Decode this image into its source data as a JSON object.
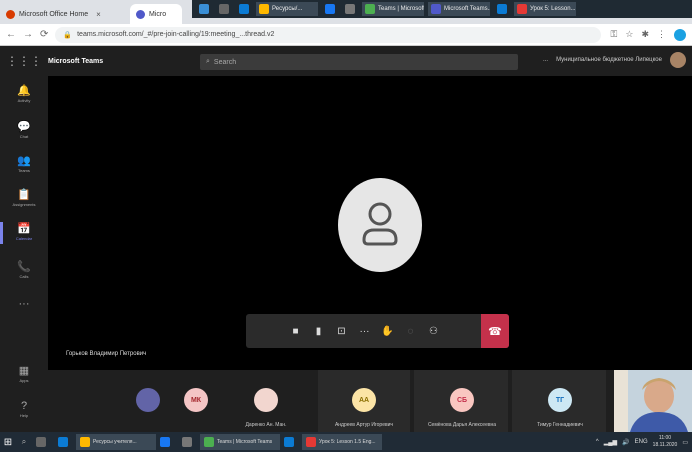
{
  "browser": {
    "tabs": [
      {
        "label": "Microsoft Office Home",
        "color": "#d83b01"
      },
      {
        "label": "Micro",
        "color": "#5059c9"
      }
    ],
    "url": "teams.microsoft.com/_#/pre-join-calling/19:meeting_...thread.v2"
  },
  "overlay_taskbar": [
    {
      "label": "",
      "color": "#3a8fd6"
    },
    {
      "label": "",
      "color": "#666666"
    },
    {
      "label": "",
      "color": "#0b7bd4"
    },
    {
      "label": "Ресурсы/...",
      "color": "#ffb900"
    },
    {
      "label": "",
      "color": "#1877f2"
    },
    {
      "label": "",
      "color": "#777777"
    },
    {
      "label": "Teams | Microsoft...",
      "color": "#4caf50"
    },
    {
      "label": "Microsoft Teams...",
      "color": "#5059c9"
    },
    {
      "label": "",
      "color": "#0b7bd4"
    },
    {
      "label": "Урок 5: Lesson...",
      "color": "#e53935"
    }
  ],
  "teams": {
    "title": "Microsoft Teams",
    "search_placeholder": "Search",
    "header_more": "...",
    "org_name": "Муниципальное бюджетное Липецкое",
    "rail": [
      {
        "icon": "bell-icon",
        "glyph": "🔔",
        "label": "Activity"
      },
      {
        "icon": "chat-icon",
        "glyph": "💬",
        "label": "Chat"
      },
      {
        "icon": "teams-icon",
        "glyph": "👥",
        "label": "Teams"
      },
      {
        "icon": "assignments-icon",
        "glyph": "📋",
        "label": "Assignments"
      },
      {
        "icon": "calendar-icon",
        "glyph": "📅",
        "label": "Calendar"
      },
      {
        "icon": "calls-icon",
        "glyph": "📞",
        "label": "Calls"
      },
      {
        "icon": "more-icon",
        "glyph": "···",
        "label": ""
      },
      {
        "icon": "apps-icon",
        "glyph": "▦",
        "label": "Apps"
      },
      {
        "icon": "help-icon",
        "glyph": "?",
        "label": "Help"
      }
    ],
    "stage_participant": "Горьков Владимир Петрович",
    "participants": [
      {
        "initials": "",
        "color": "#6264a7",
        "text_color": "#ffffff",
        "name": ""
      },
      {
        "initials": "МК",
        "color": "#f4c5c5",
        "text_color": "#a4262c",
        "name": ""
      },
      {
        "initials": "",
        "color": "#f2d6cf",
        "text_color": "#a4262c",
        "name": "Даренко Ан. Ман."
      },
      {
        "initials": "АА",
        "color": "#fce4a6",
        "text_color": "#8a6d00",
        "name": "Андреев Артур Игоревич"
      },
      {
        "initials": "СБ",
        "color": "#f9c6c0",
        "text_color": "#c4314b",
        "name": "Семёнова Дарья Алексеевна"
      },
      {
        "initials": "ТГ",
        "color": "#cde8f4",
        "text_color": "#0f6cbd",
        "name": "Тимур Геннадиевич"
      }
    ]
  },
  "windows_taskbar": {
    "items": [
      {
        "label": "",
        "color": "#666666"
      },
      {
        "label": "",
        "color": "#0b7bd4"
      },
      {
        "label": "Ресурсы учителя...",
        "color": "#ffb900"
      },
      {
        "label": "",
        "color": "#1877f2"
      },
      {
        "label": "",
        "color": "#777777"
      },
      {
        "label": "Teams | Microsoft Teams",
        "color": "#4caf50"
      },
      {
        "label": "",
        "color": "#0b7bd4"
      },
      {
        "label": "Урок 5: Lesson 1.5 Eng...",
        "color": "#e53935"
      }
    ],
    "lang": "ENG",
    "time": "11:00",
    "date": "18.11.2020"
  }
}
